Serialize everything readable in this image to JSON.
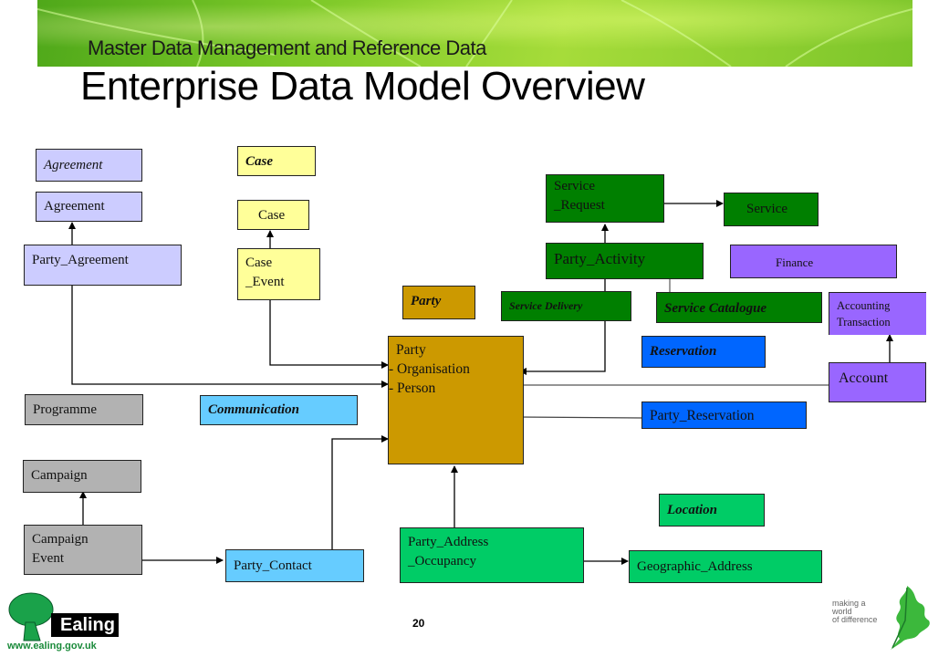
{
  "header": {
    "subtitle": "Master Data Management and Reference Data",
    "title": "Enterprise Data Model Overview"
  },
  "colors": {
    "agreement": "#ccccff",
    "case": "#ffff99",
    "party": "#cc9900",
    "service": "#007f00",
    "finance": "#9966ff",
    "reservation": "#0066ff",
    "communication": "#66ccff",
    "campaign": "#b2b2b2",
    "location": "#00cc66"
  },
  "diagram": {
    "agreement_group": {
      "header": "Agreement",
      "agreement": "Agreement",
      "party_agreement": "Party_Agreement"
    },
    "case_group": {
      "header": "Case",
      "case": "Case",
      "case_event_line1": "Case",
      "case_event_line2": "_Event"
    },
    "service_group": {
      "service_request_line1": "Service",
      "service_request_line2": "_Request",
      "service": "Service",
      "party_activity": "Party_Activity",
      "service_delivery": "Service Delivery",
      "service_catalogue": "Service Catalogue"
    },
    "finance_group": {
      "header": "Finance",
      "accounting_line1": "Accounting",
      "accounting_line2": "Transaction",
      "account": "Account"
    },
    "party_group": {
      "header": "Party",
      "party_line1": "Party",
      "party_line2": "- Organisation",
      "party_line3": "- Person"
    },
    "reservation_group": {
      "header": "Reservation",
      "party_reservation": "Party_Reservation"
    },
    "communication_group": {
      "header": "Communication",
      "party_contact": "Party_Contact"
    },
    "campaign_group": {
      "programme": "Programme",
      "campaign": "Campaign",
      "campaign_event_line1": "Campaign",
      "campaign_event_line2": "Event"
    },
    "location_group": {
      "header": "Location",
      "party_address_line1": "Party_Address",
      "party_address_line2": "_Occupancy",
      "geographic_address": "Geographic_Address"
    }
  },
  "footer": {
    "page_number": "20",
    "logo_text": "Ealing",
    "logo_url": "www.ealing.gov.uk",
    "tagline_line1": "making a world",
    "tagline_line2": "of difference"
  }
}
